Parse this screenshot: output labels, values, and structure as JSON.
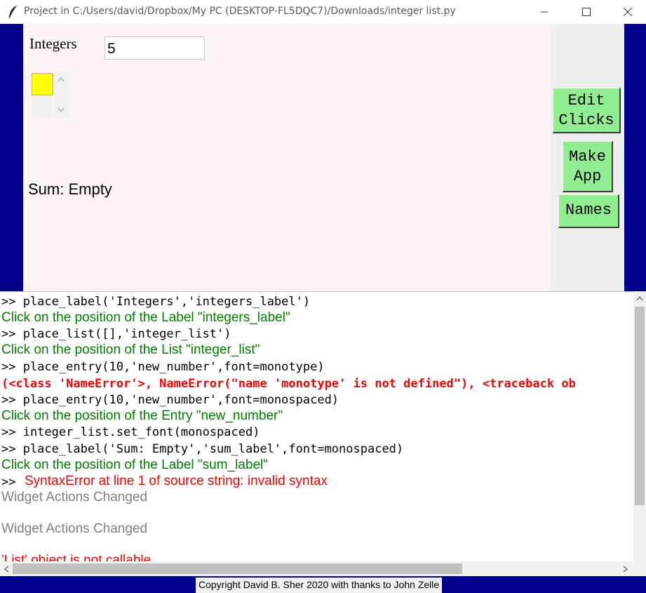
{
  "window": {
    "title": "Project in C:/Users/david/Dropbox/My PC (DESKTOP-FL5DQC7)/Downloads/integer list.py",
    "minimize": "—",
    "maximize": "☐",
    "close": "✕"
  },
  "canvas": {
    "integers_label": "Integers",
    "entry_value": "5",
    "sum_label": "Sum: Empty"
  },
  "buttons": {
    "edit_clicks": "Edit\nClicks",
    "make_app": "Make\nApp",
    "names": "Names"
  },
  "console": {
    "lines": [
      ">> place_label('Integers','integers_label')",
      "Click on the position of the Label \"integers_label\"",
      ">> place_list([],'integer_list')",
      "Click on the position of the List \"integer_list\"",
      ">> place_entry(10,'new_number',font=monotype)",
      "(<class 'NameError'>, NameError(\"name 'monotype' is not defined\"), <traceback ob",
      ">> place_entry(10,'new_number',font=monospaced)",
      "Click on the position of the Entry \"new_number\"",
      ">> integer_list.set_font(monospaced)",
      ">> place_label('Sum: Empty','sum_label',font=monospaced)",
      "Click on the position of the Label \"sum_label\"",
      ">>",
      "SyntaxError at line 1 of source string: invalid syntax",
      "Widget Actions Changed",
      "Widget Actions Changed",
      "'List' object is not callable"
    ]
  },
  "footer": {
    "copyright": "Copyright David B. Sher 2020 with thanks to John Zelle"
  },
  "colors": {
    "frame": "#00008b",
    "button_green": "#90ee90",
    "list_selected": "#ffff00",
    "message_green": "#008000",
    "error_red": "#ff0000"
  }
}
